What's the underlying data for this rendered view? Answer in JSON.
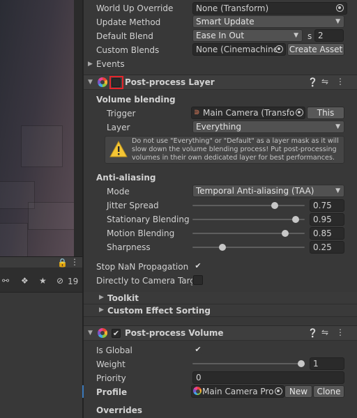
{
  "colors": {
    "highlight": "#e4252b",
    "accent_bar": "#3a79bb",
    "warning": "#f4c534"
  },
  "hierarchy": {
    "lock_icon": "lock-icon",
    "hidden_count": "19"
  },
  "top_fields": [
    {
      "label": "World Up Override",
      "value": "None (Transform)"
    },
    {
      "label": "Update Method",
      "value": "Smart Update"
    },
    {
      "label": "Default Blend",
      "value": "Ease In Out",
      "suffix": "s",
      "number": "2"
    },
    {
      "label": "Custom Blends",
      "value": "None (Cinemachine",
      "button": "Create Asset"
    }
  ],
  "events_label": "Events",
  "post_process_layer": {
    "title": "Post-process Layer",
    "volume_blending": {
      "heading": "Volume blending",
      "trigger_label": "Trigger",
      "trigger_value": "Main Camera (Transfo",
      "this_button": "This",
      "layer_label": "Layer",
      "layer_value": "Everything",
      "warning": "Do not use \"Everything\" or \"Default\" as a layer mask as it will slow down the volume blending process! Put post-processing volumes in their own dedicated layer for best performances."
    },
    "anti_aliasing": {
      "heading": "Anti-aliasing",
      "mode_label": "Mode",
      "mode_value": "Temporal Anti-aliasing (TAA)",
      "sliders": [
        {
          "label": "Jitter Spread",
          "value": "0.75",
          "fraction": 0.75
        },
        {
          "label": "Stationary Blending",
          "value": "0.95",
          "fraction": 0.95
        },
        {
          "label": "Motion Blending",
          "value": "0.85",
          "fraction": 0.85
        },
        {
          "label": "Sharpness",
          "value": "0.25",
          "fraction": 0.25
        }
      ]
    },
    "stop_nan_label": "Stop NaN Propagation",
    "stop_nan_checked": true,
    "direct_to_camera_label": "Directly to Camera Targe",
    "direct_to_camera_checked": false,
    "toolkit_label": "Toolkit",
    "custom_sorting_label": "Custom Effect Sorting"
  },
  "post_process_volume": {
    "title": "Post-process Volume",
    "is_global_label": "Is Global",
    "is_global_checked": true,
    "weight_label": "Weight",
    "weight_value": "1",
    "weight_fraction": 1,
    "priority_label": "Priority",
    "priority_value": "0",
    "profile_label": "Profile",
    "profile_value": "Main Camera Pro",
    "new_button": "New",
    "clone_button": "Clone",
    "overrides_label": "Overrides"
  }
}
